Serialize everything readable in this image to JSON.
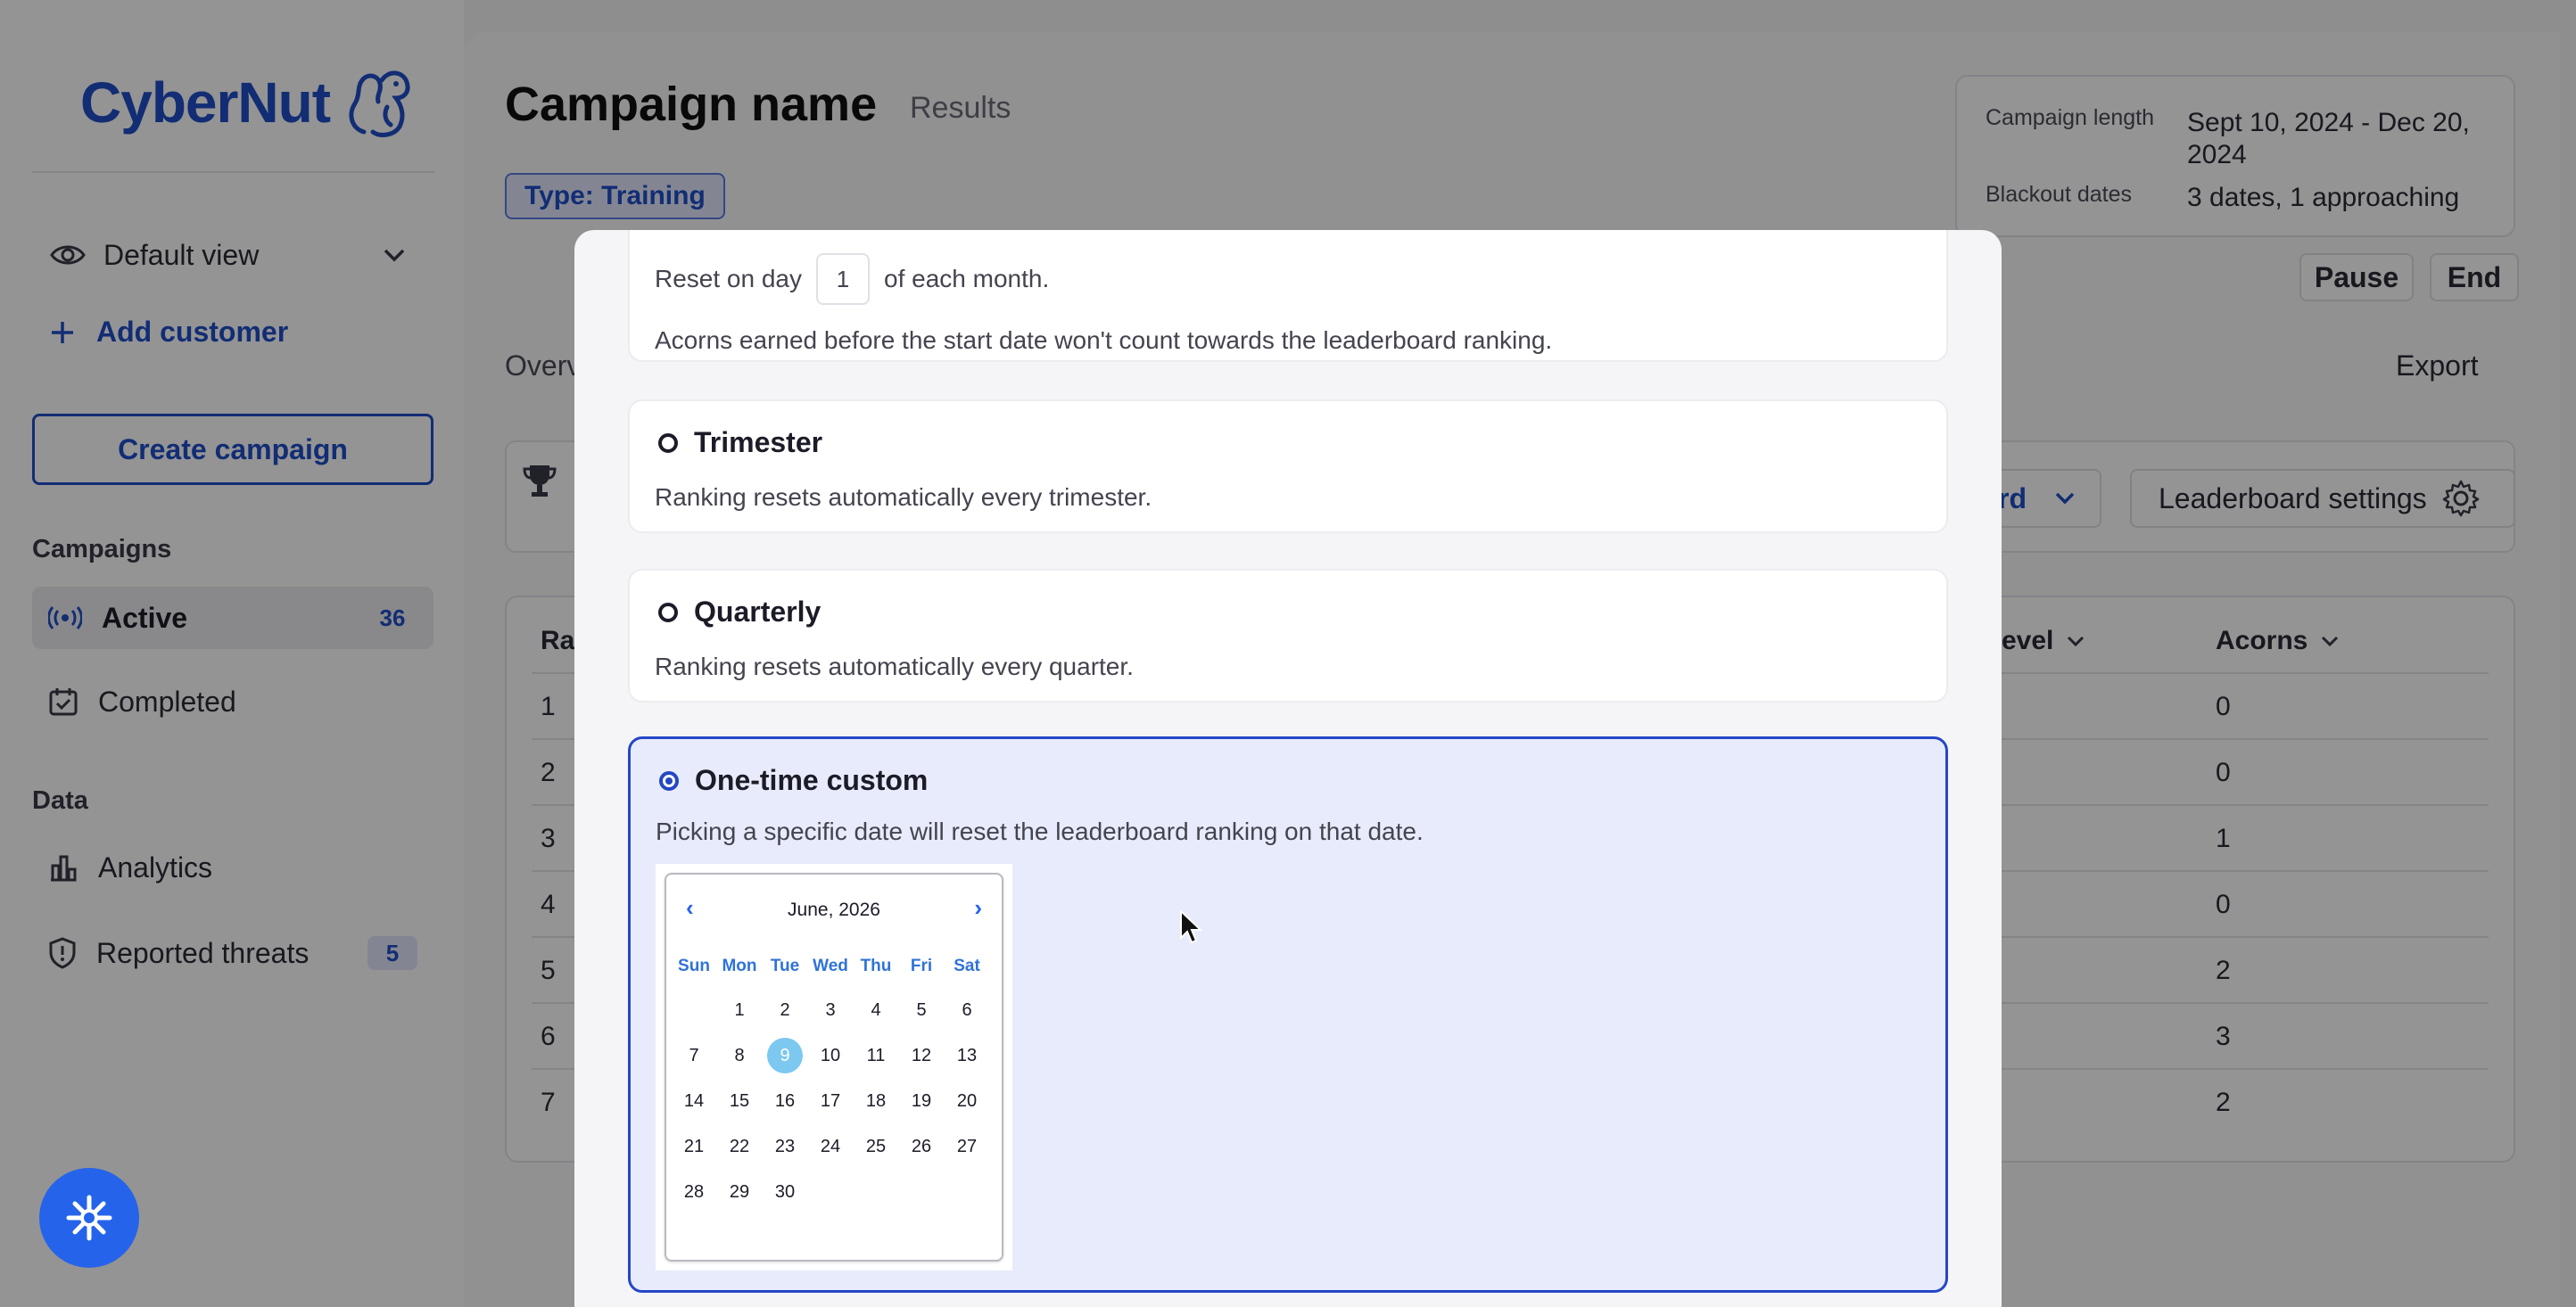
{
  "brand": {
    "name": "CyberNut"
  },
  "sidebar": {
    "view_label": "Default view",
    "add_customer_label": "Add customer",
    "create_campaign_label": "Create campaign",
    "campaigns_heading": "Campaigns",
    "data_heading": "Data",
    "items": [
      {
        "label": "Active",
        "count": "36"
      },
      {
        "label": "Completed"
      },
      {
        "label": "Analytics"
      },
      {
        "label": "Reported threats",
        "count": "5"
      }
    ]
  },
  "header": {
    "title": "Campaign name",
    "subtitle": "Results",
    "type_badge": "Type: Training",
    "campaign_length_label": "Campaign length",
    "campaign_length_value": "Sept 10, 2024 - Dec 20, 2024",
    "blackout_label": "Blackout dates",
    "blackout_value": "3 dates, 1 approaching",
    "pause_label": "Pause",
    "end_label": "End"
  },
  "tabs": {
    "overview_fragment": "Overv",
    "export_label": "Export"
  },
  "leaderboard": {
    "dropdown_fragment": "rd",
    "settings_label": "Leaderboard settings",
    "columns": {
      "rank_fragment": "Ra",
      "level_fragment": "evel",
      "acorns": "Acorns"
    },
    "rows": [
      {
        "rank": "1",
        "acorns": "0"
      },
      {
        "rank": "2",
        "acorns": "0"
      },
      {
        "rank": "3",
        "acorns": "1"
      },
      {
        "rank": "4",
        "acorns": "0"
      },
      {
        "rank": "5",
        "acorns": "2"
      },
      {
        "rank": "6",
        "acorns": "3"
      },
      {
        "rank": "7",
        "acorns": "2"
      }
    ]
  },
  "modal": {
    "monthly": {
      "reset_prefix": "Reset on day",
      "reset_day": "1",
      "reset_suffix": "of each month.",
      "note": "Acorns earned before the start date won't count towards the leaderboard ranking."
    },
    "trimester": {
      "title": "Trimester",
      "desc": "Ranking resets automatically every trimester."
    },
    "quarterly": {
      "title": "Quarterly",
      "desc": "Ranking resets automatically every quarter."
    },
    "custom": {
      "title": "One-time custom",
      "desc": "Picking a specific date will reset the leaderboard ranking on that date.",
      "selected": true
    }
  },
  "calendar": {
    "month_label": "June, 2026",
    "prev": "‹",
    "next": "›",
    "weekdays": [
      "Sun",
      "Mon",
      "Tue",
      "Wed",
      "Thu",
      "Fri",
      "Sat"
    ],
    "first_weekday_index": 1,
    "days_in_month": 30,
    "selected_day": 9
  },
  "colors": {
    "brand_blue": "#1f4fc8",
    "selected_day": "#7cc8f0",
    "fab": "#2563eb"
  }
}
